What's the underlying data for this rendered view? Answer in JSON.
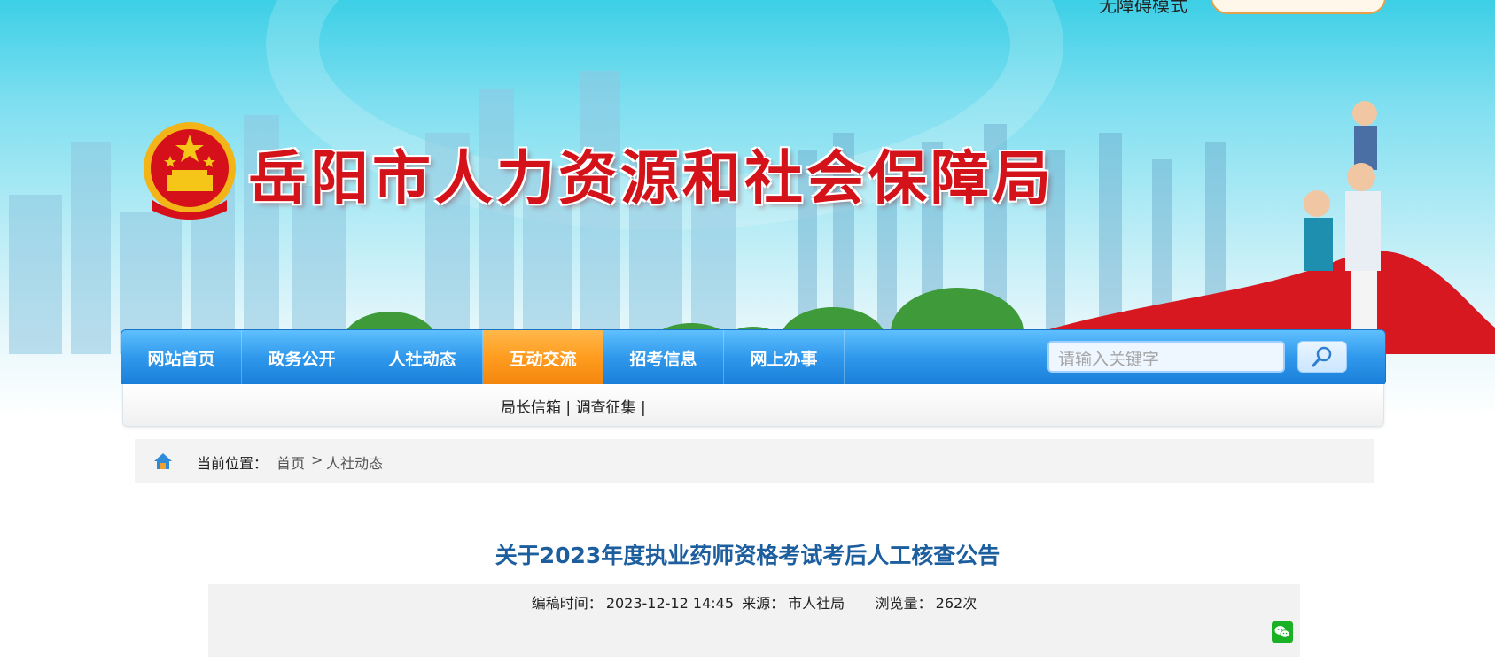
{
  "header": {
    "site_title": "岳阳市人力资源和社会保障局",
    "top_text": "无障碍模式"
  },
  "nav": {
    "items": [
      {
        "label": "网站首页",
        "active": false
      },
      {
        "label": "政务公开",
        "active": false
      },
      {
        "label": "人社动态",
        "active": false
      },
      {
        "label": "互动交流",
        "active": true
      },
      {
        "label": "招考信息",
        "active": false
      },
      {
        "label": "网上办事",
        "active": false
      }
    ],
    "search_placeholder": "请输入关键字"
  },
  "subnav": {
    "link1": "局长信箱",
    "sep1": " | ",
    "link2": "调查征集",
    "sep2": " |"
  },
  "breadcrumb": {
    "label": "当前位置：",
    "home": "首页",
    "sep": ">",
    "current": "人社动态"
  },
  "article": {
    "title": "关于2023年度执业药师资格考试考后人工核查公告",
    "edit_time_label": "编稿时间：",
    "edit_time": "2023-12-12 14:45",
    "source_label": "来源：",
    "source": "市人社局",
    "views_label": "浏览量：",
    "views": "262次"
  },
  "colors": {
    "nav_blue": "#2f98ec",
    "nav_active": "#ff9c1f",
    "title_red": "#d4121a",
    "article_title": "#1d5e9e"
  }
}
